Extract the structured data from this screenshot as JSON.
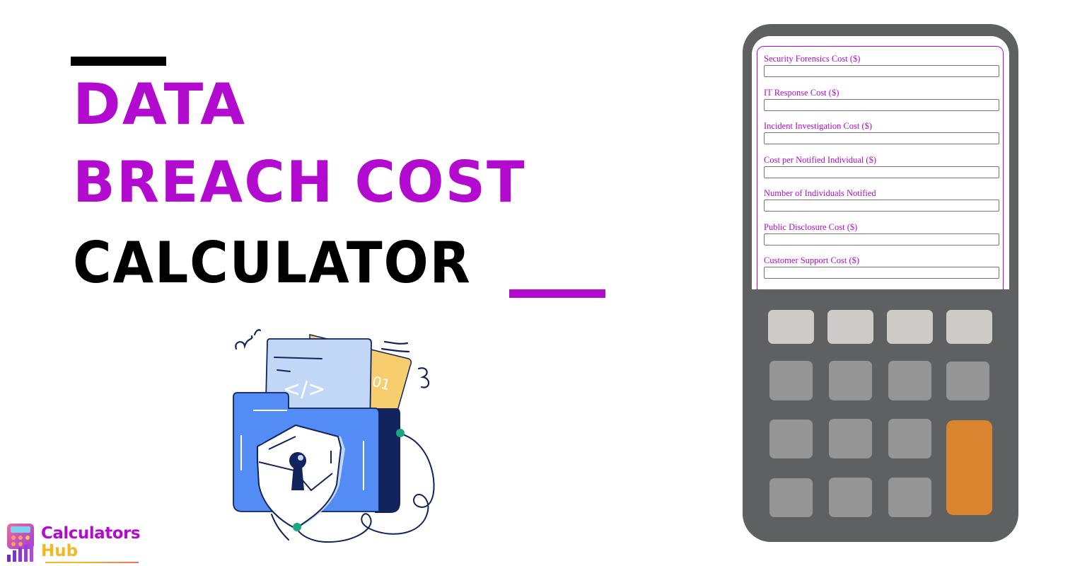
{
  "header": {
    "title_line1": "DATA",
    "title_line2": "BREACH COST",
    "title_line3": "CALCULATOR"
  },
  "colors": {
    "accent": "#b30ad0",
    "text_dark": "#000000",
    "calculator_body": "#5f6062",
    "key_light": "#cccbc8",
    "key_mid": "#959595",
    "key_equals": "#d98530",
    "logo_secondary": "#f2b824"
  },
  "illustration": {
    "icon": "folder-shield-lock-icon",
    "code_glyph": "</>",
    "binary_glyph": "01"
  },
  "calculator": {
    "fields": [
      {
        "label": "Security Forensics Cost ($)",
        "value": "",
        "placeholder": ""
      },
      {
        "label": "IT Response Cost ($)",
        "value": "",
        "placeholder": ""
      },
      {
        "label": "Incident Investigation Cost ($)",
        "value": "",
        "placeholder": ""
      },
      {
        "label": "Cost per Notified Individual ($)",
        "value": "",
        "placeholder": ""
      },
      {
        "label": "Number of Individuals Notified",
        "value": "",
        "placeholder": ""
      },
      {
        "label": "Public Disclosure Cost ($)",
        "value": "",
        "placeholder": ""
      },
      {
        "label": "Customer Support Cost ($)",
        "value": "",
        "placeholder": ""
      }
    ]
  },
  "logo": {
    "name_line1": "Calculators",
    "name_line2": "Hub",
    "icon": "calculator-chart-icon"
  }
}
